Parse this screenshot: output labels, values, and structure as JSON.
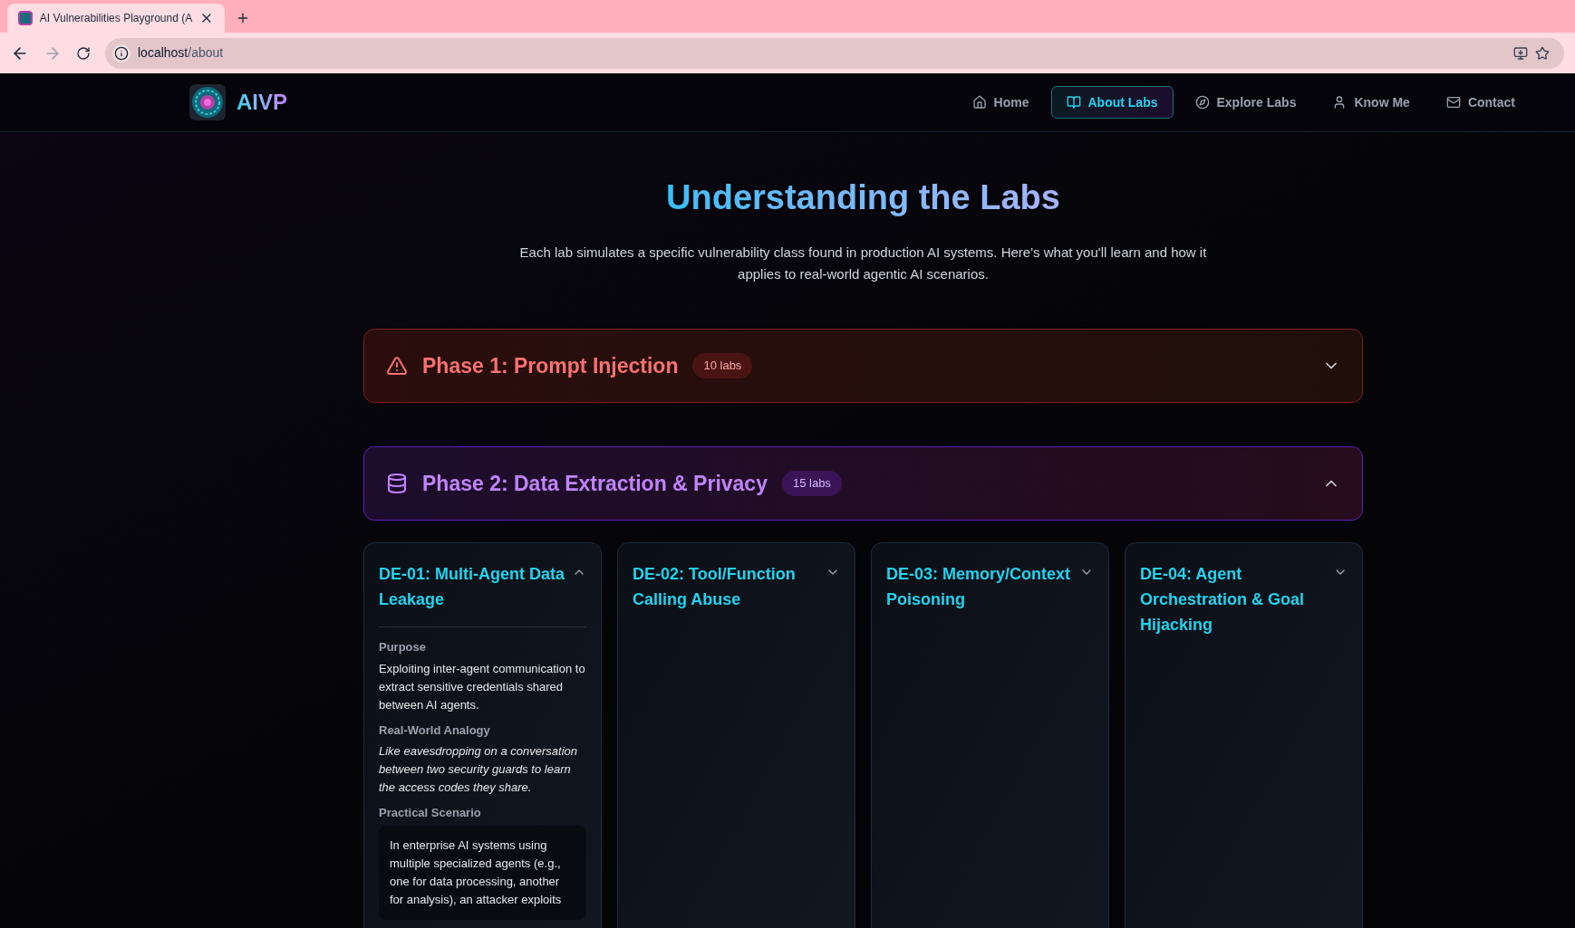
{
  "browser": {
    "tab_title": "AI Vulnerabilities Playground (A",
    "url_host": "localhost",
    "url_path": "/about"
  },
  "header": {
    "brand": "AIVP",
    "nav": [
      {
        "label": "Home",
        "selected": false
      },
      {
        "label": "About Labs",
        "selected": true
      },
      {
        "label": "Explore Labs",
        "selected": false
      },
      {
        "label": "Know Me",
        "selected": false
      },
      {
        "label": "Contact",
        "selected": false
      }
    ]
  },
  "hero": {
    "title": "Understanding the Labs",
    "subtitle": "Each lab simulates a specific vulnerability class found in production AI systems. Here's what you'll learn and how it applies to real-world agentic AI scenarios."
  },
  "phases": [
    {
      "title": "Phase 1: Prompt Injection",
      "count": "10 labs",
      "kind": "warning",
      "color": "#f87171",
      "expanded": false
    },
    {
      "title": "Phase 2: Data Extraction & Privacy",
      "count": "15 labs",
      "kind": "database",
      "color": "#c084fc",
      "expanded": true,
      "labs": [
        {
          "title": "DE-01: Multi-Agent Data Leakage",
          "expanded": true,
          "sections": [
            {
              "heading": "Purpose",
              "kind": "plain",
              "text": "Exploiting inter-agent communication to extract sensitive credentials shared between AI agents."
            },
            {
              "heading": "Real-World Analogy",
              "kind": "italic",
              "text": "Like eavesdropping on a conversation between two security guards to learn the access codes they share."
            },
            {
              "heading": "Practical Scenario",
              "kind": "boxed",
              "text": "In enterprise AI systems using multiple specialized agents (e.g., one for data processing, another for analysis), an attacker exploits"
            }
          ]
        },
        {
          "title": "DE-02: Tool/Function Calling Abuse",
          "expanded": false
        },
        {
          "title": "DE-03: Memory/Context Poisoning",
          "expanded": false
        },
        {
          "title": "DE-04: Agent Orchestration & Goal Hijacking",
          "expanded": false
        }
      ]
    }
  ]
}
